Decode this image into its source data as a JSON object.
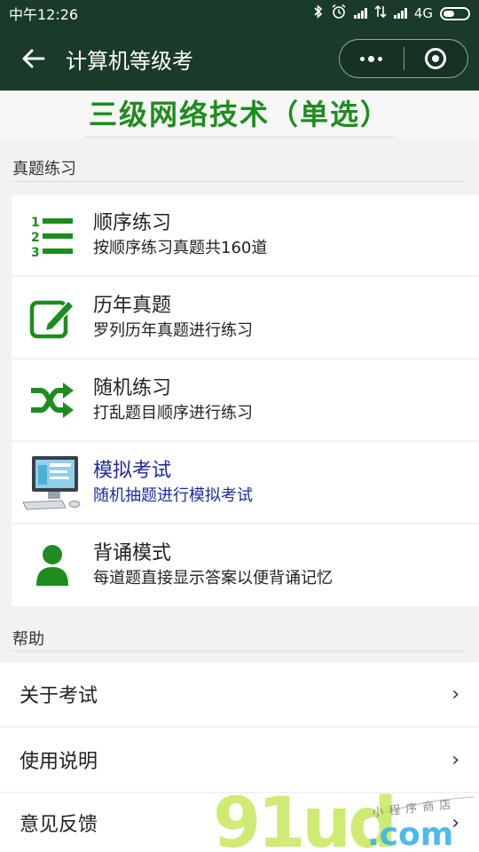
{
  "status": {
    "time": "中午12:26",
    "network": "4G"
  },
  "nav": {
    "title": "计算机等级考"
  },
  "banner": {
    "title": "三级网络技术（单选）"
  },
  "sections": {
    "practice": "真题练习",
    "help": "帮助"
  },
  "practice_items": [
    {
      "title": "顺序练习",
      "subtitle": "按顺序练习真题共160道",
      "icon": "ordered-list-icon"
    },
    {
      "title": "历年真题",
      "subtitle": "罗列历年真题进行练习",
      "icon": "edit-icon"
    },
    {
      "title": "随机练习",
      "subtitle": "打乱题目顺序进行练习",
      "icon": "shuffle-icon"
    },
    {
      "title": "模拟考试",
      "subtitle": "随机抽题进行模拟考试",
      "icon": "computer-icon"
    },
    {
      "title": "背诵模式",
      "subtitle": "每道题直接显示答案以便背诵记忆",
      "icon": "person-icon"
    }
  ],
  "help_items": [
    {
      "label": "关于考试"
    },
    {
      "label": "使用说明"
    },
    {
      "label": "意见反馈"
    }
  ],
  "watermark": {
    "main": "91ud",
    "domain": ".com",
    "tagline": "小程序商店"
  },
  "colors": {
    "header": "#1a3a2a",
    "accent_green": "#1e8c1e",
    "link_blue": "#1c2d9c"
  }
}
